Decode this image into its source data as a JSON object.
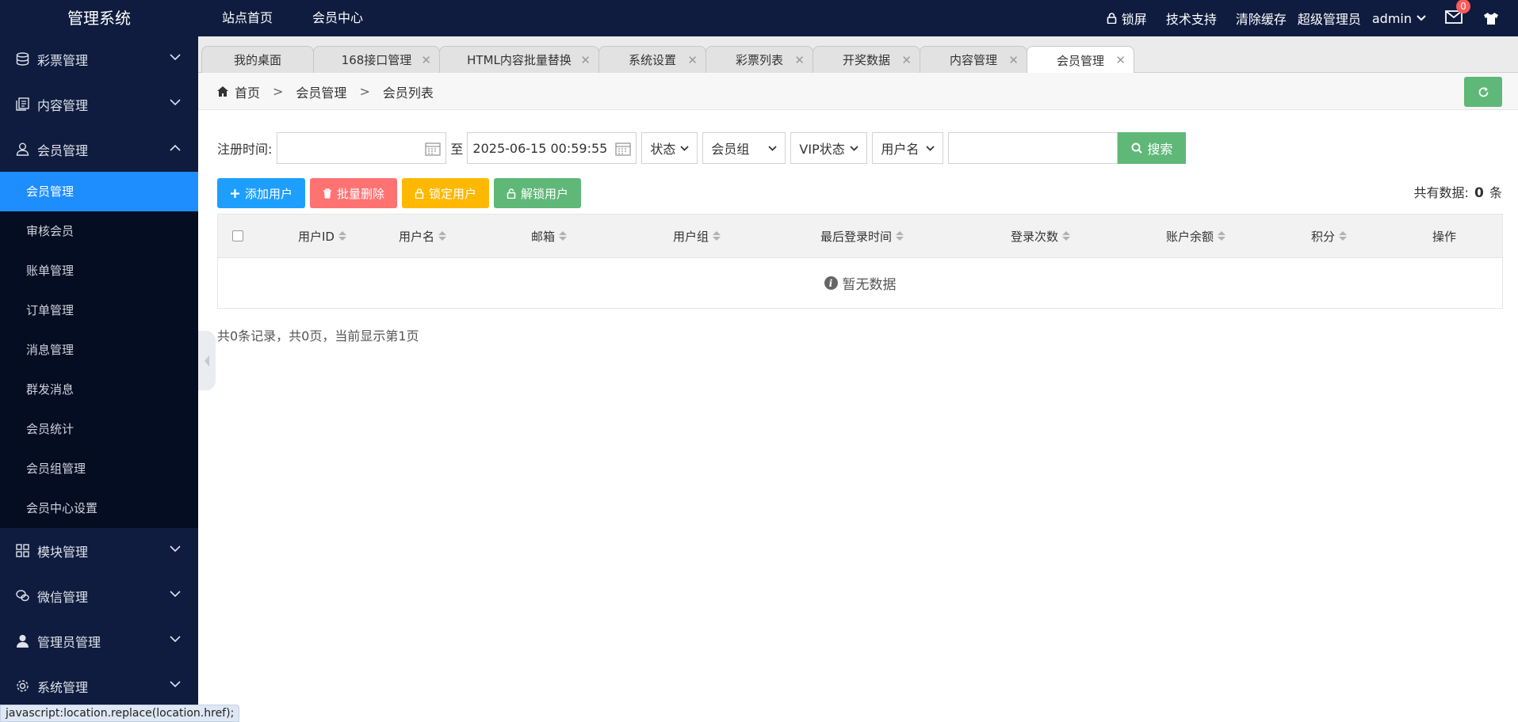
{
  "app": {
    "title": "管理系统"
  },
  "topnav": {
    "items": [
      "站点首页",
      "会员中心"
    ]
  },
  "topright": {
    "lock_label": "锁屏",
    "support_label": "技术支持",
    "clear_cache_label": "清除缓存",
    "role_label": "超级管理员",
    "user_label": "admin",
    "mail_badge": "0"
  },
  "sidebar": {
    "groups_top": [
      {
        "label": "彩票管理",
        "icon": "database-icon"
      },
      {
        "label": "内容管理",
        "icon": "documents-icon"
      },
      {
        "label": "会员管理",
        "icon": "user-icon"
      }
    ],
    "member_items": [
      "会员管理",
      "审核会员",
      "账单管理",
      "订单管理",
      "消息管理",
      "群发消息",
      "会员统计",
      "会员组管理",
      "会员中心设置"
    ],
    "groups_bottom": [
      {
        "label": "模块管理",
        "icon": "grid-icon"
      },
      {
        "label": "微信管理",
        "icon": "wechat-icon"
      },
      {
        "label": "管理员管理",
        "icon": "admin-user-icon"
      },
      {
        "label": "系统管理",
        "icon": "gear-icon"
      }
    ]
  },
  "tabs": [
    "我的桌面",
    "168接口管理",
    "HTML内容批量替换",
    "系统设置",
    "彩票列表",
    "开奖数据",
    "内容管理",
    "会员管理"
  ],
  "breadcrumb": {
    "home": "首页",
    "items": [
      "会员管理",
      "会员列表"
    ],
    "separator": ">"
  },
  "filter": {
    "reg_time_label": "注册时间:",
    "start_value": "",
    "to_label": "至",
    "end_value": "2025-06-15 00:59:55",
    "status_label": "状态",
    "group_label": "会员组",
    "vip_label": "VIP状态",
    "field_label": "用户名",
    "keyword_value": "",
    "search_label": "搜索"
  },
  "actions": {
    "add": "添加用户",
    "batch_delete": "批量删除",
    "lock": "锁定用户",
    "unlock": "解锁用户"
  },
  "total": {
    "prefix": "共有数据:",
    "count": "0",
    "suffix": "条"
  },
  "table": {
    "columns": [
      "用户ID",
      "用户名",
      "邮箱",
      "用户组",
      "最后登录时间",
      "登录次数",
      "账户余额",
      "积分",
      "操作"
    ],
    "empty_text": "暂无数据"
  },
  "pagination": {
    "summary": "共0条记录，共0页，当前显示第1页"
  },
  "statusbar": {
    "text": "javascript:location.replace(location.href);"
  },
  "colors": {
    "topbar": "#0f1c3f",
    "sidebar_sub": "#050d22",
    "active": "#1e8eff",
    "green": "#5fb878",
    "blue": "#1e9fff",
    "red": "#ff5a5a",
    "orange": "#ffb800"
  }
}
